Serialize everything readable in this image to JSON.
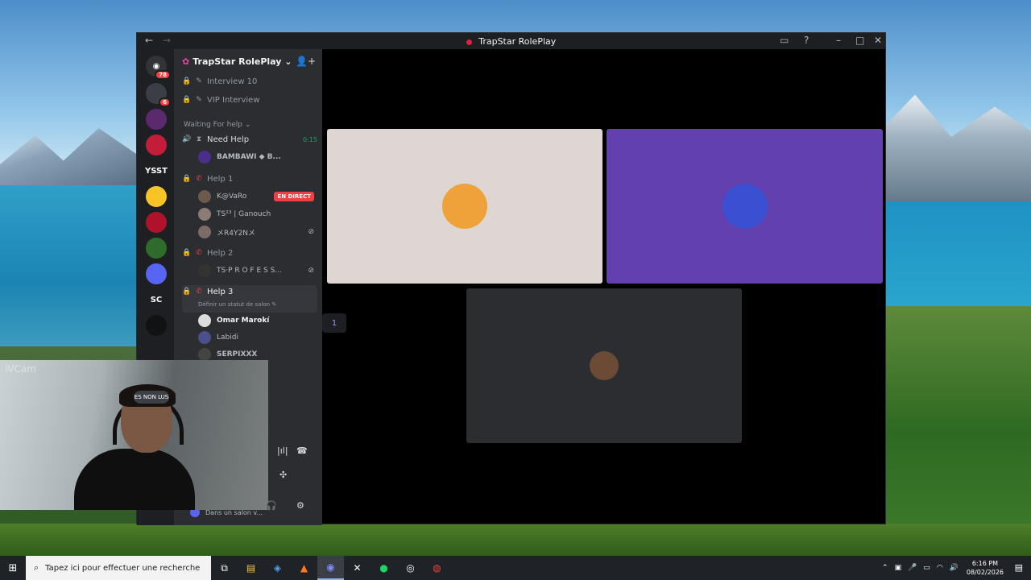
{
  "window": {
    "title": "TrapStar RolePlay"
  },
  "rail": {
    "home_badge": "78",
    "servers": [
      {
        "label": "",
        "color": "#3b3e44",
        "badge": "6"
      },
      {
        "label": "",
        "color": "#5b2a6e",
        "badge": ""
      },
      {
        "label": "",
        "color": "#c41d3a",
        "badge": ""
      },
      {
        "label": "YSST",
        "color": "#1e1f22",
        "badge": ""
      },
      {
        "label": "",
        "color": "#f7c325",
        "badge": ""
      },
      {
        "label": "",
        "color": "#b0112b",
        "badge": ""
      },
      {
        "label": "",
        "color": "#2f6b2a",
        "badge": ""
      },
      {
        "label": "",
        "color": "#5865f2",
        "badge": ""
      },
      {
        "label": "SC",
        "color": "#1e1f22",
        "badge": ""
      },
      {
        "label": "",
        "color": "#111214",
        "badge": ""
      }
    ]
  },
  "sidebar": {
    "server_name": "TrapStar RolePlay",
    "channels_top": [
      "Interview 10",
      "VIP Interview"
    ],
    "category": "Waiting For help",
    "need_help": {
      "name": "Need Help",
      "timer": "0:15",
      "user": "BAMBAWI ◆ B..."
    },
    "help1": {
      "name": "Help 1",
      "users": [
        {
          "name": "K@VaRo",
          "live": "EN DIRECT"
        },
        {
          "name": "TS²³ | Ganouch",
          "live": ""
        },
        {
          "name": "メR4Y2Nメ",
          "live": ""
        }
      ]
    },
    "help2": {
      "name": "Help 2",
      "users": [
        {
          "name": "TS·P R O F E S S..."
        }
      ]
    },
    "help3": {
      "name": "Help 3",
      "status": "Définir un statut de salon",
      "users": [
        {
          "name": "Omar Marokí"
        },
        {
          "name": "Labidi"
        },
        {
          "name": "SERPIXXX"
        }
      ]
    },
    "unread_label": "ES NON LUS",
    "voice_status": "Dans un salon v..."
  },
  "stage": {
    "tiles": [
      {
        "bg": "#ddd6d3",
        "avatar_color": "#f0a23a"
      },
      {
        "bg": "#6240ad",
        "avatar_color": "#3a4fd1"
      },
      {
        "bg": "#2b2d31",
        "avatar_color": "#6b4b35"
      }
    ],
    "toast": "1"
  },
  "webcam": {
    "label": "iVCam"
  },
  "taskbar": {
    "search_placeholder": "Tapez ici pour effectuer une recherche",
    "time": "6:16 PM",
    "date": "08/02/2026"
  }
}
